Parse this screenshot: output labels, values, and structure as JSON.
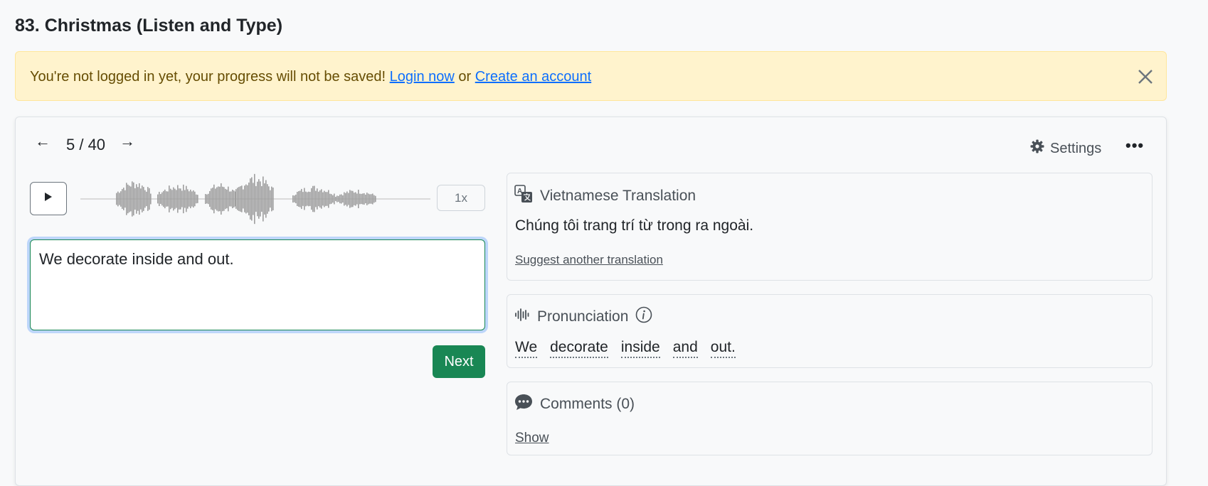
{
  "page": {
    "title": "83. Christmas (Listen and Type)"
  },
  "alert": {
    "message": "You're not logged in yet, your progress will not be saved!",
    "login_link": "Login now",
    "or_text": "or",
    "create_link": "Create an account",
    "close_icon": "close-icon"
  },
  "nav": {
    "prev_icon": "arrow-left-icon",
    "counter": "5 / 40",
    "next_icon": "arrow-right-icon",
    "settings_label": "Settings",
    "settings_icon": "gear-icon",
    "more_icon": "ellipsis-icon"
  },
  "player": {
    "play_icon": "play-icon",
    "speed_label": "1x"
  },
  "answer": {
    "value": "We decorate inside and out.",
    "next_label": "Next"
  },
  "translation": {
    "icon": "translate-icon",
    "heading": "Vietnamese Translation",
    "text": "Chúng tôi trang trí từ trong ra ngoài.",
    "suggest_link": "Suggest another translation"
  },
  "pronunciation": {
    "icon": "soundwave-icon",
    "heading": "Pronunciation",
    "info_icon": "info-icon",
    "words": [
      "We",
      "decorate",
      "inside",
      "and",
      "out."
    ]
  },
  "comments": {
    "icon": "chat-icon",
    "heading": "Comments (0)",
    "show_link": "Show"
  },
  "colors": {
    "alert_bg": "#fff3cd",
    "success": "#198754",
    "link": "#0d6efd"
  }
}
